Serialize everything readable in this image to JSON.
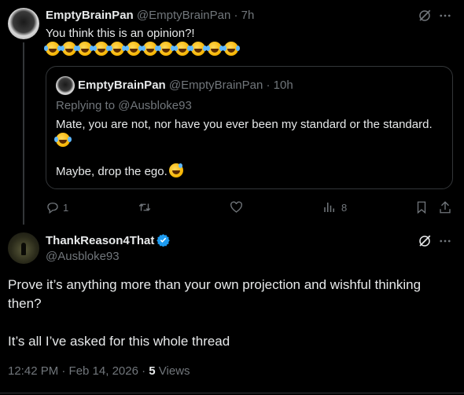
{
  "reply_tweet": {
    "display_name": "EmptyBrainPan",
    "handle": "@EmptyBrainPan",
    "time": "· 7h",
    "text": "You think this is an opinion?!",
    "emoji_count": 12,
    "quoted": {
      "display_name": "EmptyBrainPan",
      "handle": "@EmptyBrainPan",
      "time": "· 10h",
      "replying_to": "Replying to @Ausbloke93",
      "text_line1": "Mate, you are not, nor have you ever been my standard or the standard.",
      "text_line2": "Maybe, drop the ego."
    },
    "actions": {
      "reply_count": "1",
      "retweet_count": "",
      "like_count": "",
      "views_count": "8"
    }
  },
  "main_tweet": {
    "display_name": "ThankReason4That",
    "handle": "@Ausbloke93",
    "text_line1": "Prove it’s anything more than your own projection and wishful thinking then?",
    "text_line2": "It’s all I’ve asked for this whole thread",
    "timestamp": "12:42 PM · Feb 14, 2026 · ",
    "views_count": "5",
    "views_label": " Views"
  },
  "colors": {
    "background": "#000000",
    "text": "#e7e9ea",
    "muted": "#71767b",
    "verified": "#1d9bf0",
    "border": "#333639"
  }
}
